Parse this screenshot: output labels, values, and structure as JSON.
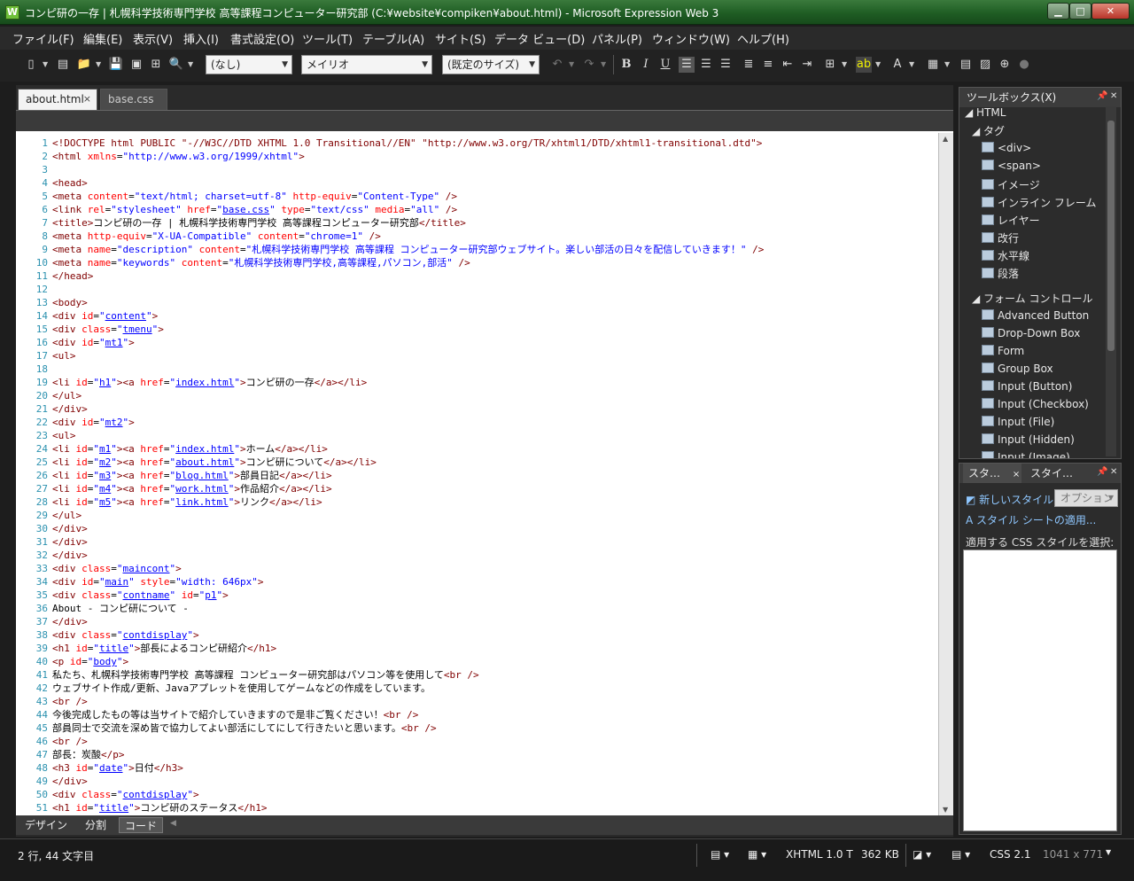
{
  "window": {
    "title": "コンピ研の一存 | 札幌科学技術専門学校 高等課程コンピューター研究部 (C:¥website¥compiken¥about.html) - Microsoft Expression Web 3",
    "buttons": {
      "minimize": "▁",
      "maximize": "□",
      "close": "✕"
    }
  },
  "menu": [
    "ファイル(F)",
    "編集(E)",
    "表示(V)",
    "挿入(I)",
    "書式設定(O)",
    "ツール(T)",
    "テーブル(A)",
    "サイト(S)",
    "データ ビュー(D)",
    "パネル(P)",
    "ウィンドウ(W)",
    "ヘルプ(H)"
  ],
  "toolbar": {
    "style_combo": "(なし)",
    "font_combo": "メイリオ",
    "size_combo": "(既定のサイズ)",
    "bold": "B",
    "italic": "I",
    "underline": "U"
  },
  "tabs": [
    {
      "label": "about.html",
      "active": true,
      "close": "×"
    },
    {
      "label": "base.css",
      "active": false
    }
  ],
  "code": {
    "line_numbers": [
      "1",
      "2",
      "3",
      "4",
      "5",
      "6",
      "7",
      "8",
      "9",
      "10",
      "11",
      "12",
      "13",
      "14",
      "15",
      "16",
      "17",
      "18",
      "19",
      "20",
      "21",
      "22",
      "23",
      "24",
      "25",
      "26",
      "27",
      "28",
      "29",
      "30",
      "31",
      "32",
      "33",
      "34",
      "35",
      "36",
      "37",
      "38",
      "39",
      "40",
      "41",
      "42",
      "43",
      "44",
      "45",
      "46",
      "47",
      "48",
      "49",
      "50",
      "51"
    ]
  },
  "views": {
    "design": "デザイン",
    "split": "分割",
    "code": "コード"
  },
  "toolbox": {
    "title": "ツールボックス(X)",
    "html_group": "HTML",
    "tag_group": "タグ",
    "tags": [
      "<div>",
      "<span>",
      "イメージ",
      "インライン フレーム",
      "レイヤー",
      "改行",
      "水平線",
      "段落"
    ],
    "form_group": "フォーム コントロール",
    "forms": [
      "Advanced Button",
      "Drop-Down Box",
      "Form",
      "Group Box",
      "Input (Button)",
      "Input (Checkbox)",
      "Input (File)",
      "Input (Hidden)",
      "Input (Image)"
    ]
  },
  "style_panel": {
    "tab1": "スタ…",
    "tab1_close": "×",
    "tab2": "スタイ…",
    "new_style": "新しいスタイル...",
    "option": "オプション",
    "attach": "スタイル シートの適用...",
    "select_label": "適用する CSS スタイルを選択:"
  },
  "status": {
    "position": "2 行, 44 文字目",
    "doctype": "XHTML 1.0 T",
    "size": "362 KB",
    "css": "CSS 2.1",
    "dimensions": "1041 x 771"
  },
  "colors": {
    "tag": "#800000",
    "attr": "#ff0000",
    "value": "#0000ff",
    "gutter": "#2b91af"
  }
}
